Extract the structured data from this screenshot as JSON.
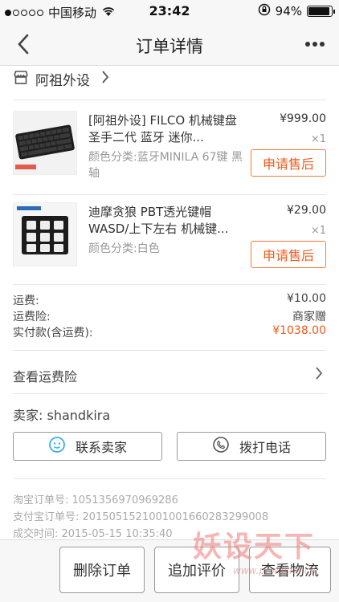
{
  "status_bar": {
    "carrier": "中国移动",
    "time": "23:42",
    "battery": "94%",
    "battery_level": 0.94
  },
  "nav": {
    "title": "订单详情"
  },
  "shop": {
    "name": "阿祖外设"
  },
  "items": [
    {
      "title": "[阿祖外设] FILCO 机械键盘 圣手二代 蓝牙 迷你...",
      "spec": "颜色分类:蓝牙MINILA 67键 黑轴",
      "price": "¥999.00",
      "qty": "×1",
      "button": "申请售后"
    },
    {
      "title": "迪摩贪狼 PBT透光键帽 WASD/上下左右 机械键...",
      "spec": "颜色分类:白色",
      "price": "¥29.00",
      "qty": "×1",
      "button": "申请售后"
    }
  ],
  "fees": {
    "shipping_label": "运费:",
    "shipping_value": "¥10.00",
    "insurance_label": "运费险:",
    "insurance_value": "商家赠",
    "paid_label": "实付款(含运费):",
    "paid_value": "¥1038.00"
  },
  "shipping_insurance_link": "查看运费险",
  "seller": {
    "label": "卖家:",
    "name": "shandkira",
    "contact_button": "联系卖家",
    "call_button": "拨打电话"
  },
  "order_meta": {
    "taobao_order": "淘宝订单号: 1051356970969286",
    "alipay_order": "支付宝订单号: 2015051521001001660283299008",
    "deal_time": "成交时间: 2015-05-15 10:35:40"
  },
  "bottom": {
    "delete": "删除订单",
    "review": "追加评价",
    "logistics": "查看物流"
  },
  "watermark": {
    "text": "妖设天下",
    "url": "www.pcwashe.cn"
  },
  "colors": {
    "accent": "#f05a1a",
    "muted": "#999999"
  }
}
